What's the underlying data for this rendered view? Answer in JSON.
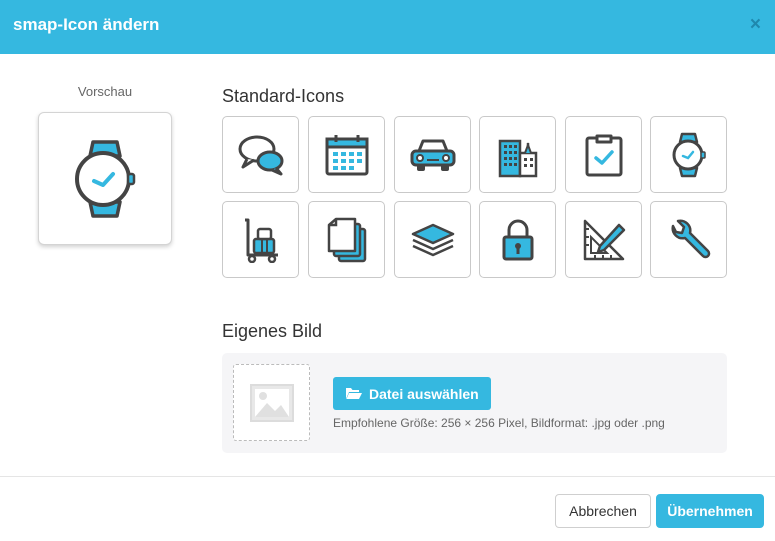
{
  "dialog": {
    "title": "smap-Icon ändern",
    "close_label": "×"
  },
  "preview": {
    "label": "Vorschau",
    "icon": "watch-icon"
  },
  "standard_icons": {
    "title": "Standard-Icons",
    "items": [
      {
        "name": "chat-bubbles-icon"
      },
      {
        "name": "calendar-icon"
      },
      {
        "name": "car-icon"
      },
      {
        "name": "buildings-icon"
      },
      {
        "name": "clipboard-check-icon"
      },
      {
        "name": "watch-icon"
      },
      {
        "name": "luggage-trolley-icon"
      },
      {
        "name": "documents-stack-icon"
      },
      {
        "name": "layers-icon"
      },
      {
        "name": "padlock-icon"
      },
      {
        "name": "ruler-pencil-icon"
      },
      {
        "name": "wrench-icon"
      }
    ]
  },
  "own_image": {
    "title": "Eigenes Bild",
    "choose_file_label": "Datei auswählen",
    "hint": "Empfohlene Größe: 256 × 256 Pixel, Bildformat: .jpg oder .png"
  },
  "footer": {
    "cancel_label": "Abbrechen",
    "apply_label": "Übernehmen"
  },
  "colors": {
    "accent": "#35b8e0",
    "icon_dark": "#444444",
    "icon_fill": "#35b8e0"
  }
}
